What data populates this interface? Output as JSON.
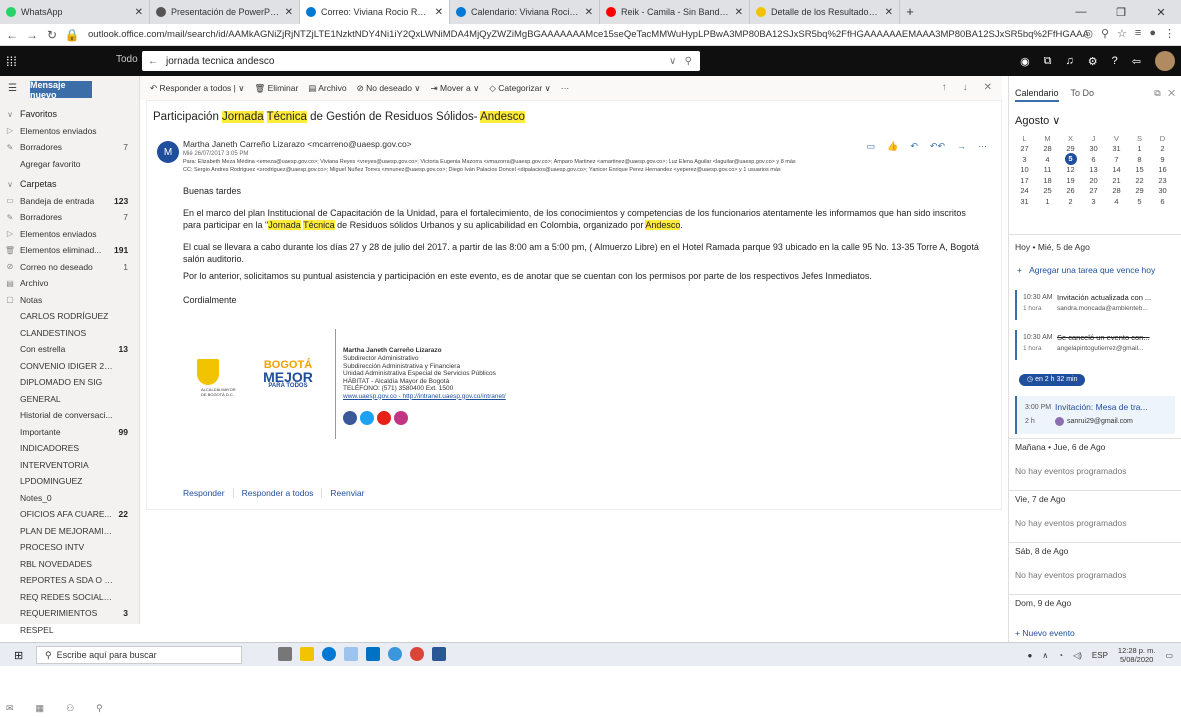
{
  "browser": {
    "tabs": [
      {
        "title": "WhatsApp",
        "color": "#25d366",
        "active": false
      },
      {
        "title": "Presentación de PowerPoint",
        "color": "#555555",
        "active": false
      },
      {
        "title": "Correo: Viviana Rocio Reyes Duc",
        "color": "#0078d4",
        "active": true
      },
      {
        "title": "Calendario: Viviana Rocio Reyes",
        "color": "#0078d4",
        "active": false
      },
      {
        "title": "Reik - Camila - Sin Bandera,",
        "color": "#ff0000",
        "active": false
      },
      {
        "title": "Detalle de los Resultados de la p",
        "color": "#f2c300",
        "active": false
      }
    ],
    "url": "outlook.office.com/mail/search/id/AAMkAGNiZjRjNTZjLTE1NzktNDY4Ni1iY2QxLWNiMDA4MjQyZWZiMgBGAAAAAAAMce15seQeTacMMWuHypLPBwA3MP80BA12SJxSR5bq%2FfHGAAAAAAEMAAA3MP80BA12SJxSR5bq%2FfHGAAAIKZujAAA%3D"
  },
  "owa": {
    "scope": "Todo",
    "search_value": "jornada tecnica andesco"
  },
  "leftnav": {
    "new_message": "Mensaje nuevo",
    "favorites_header": "Favoritos",
    "favorites": [
      {
        "label": "Elementos enviados",
        "count": "",
        "icon": "▷"
      },
      {
        "label": "Borradores",
        "count": "7",
        "icon": "✎"
      },
      {
        "label": "Agregar favorito",
        "count": "",
        "icon": ""
      }
    ],
    "folders_header": "Carpetas",
    "folders": [
      {
        "label": "Bandeja de entrada",
        "count": "123",
        "icon": "▭",
        "bold": true
      },
      {
        "label": "Borradores",
        "count": "7",
        "icon": "✎",
        "bold": false
      },
      {
        "label": "Elementos enviados",
        "count": "",
        "icon": "▷",
        "bold": false
      },
      {
        "label": "Elementos eliminad...",
        "count": "191",
        "icon": "🗑",
        "bold": true
      },
      {
        "label": "Correo no deseado",
        "count": "1",
        "icon": "⊘",
        "bold": false
      },
      {
        "label": "Archivo",
        "count": "",
        "icon": "▤",
        "bold": false
      },
      {
        "label": "Notas",
        "count": "",
        "icon": "▢",
        "bold": false
      }
    ],
    "subfolders": [
      {
        "label": "CARLOS RODRÍGUEZ",
        "count": ""
      },
      {
        "label": "CLANDESTINOS",
        "count": ""
      },
      {
        "label": "Con estrella",
        "count": "13"
      },
      {
        "label": "CONVENIO IDIGER 2015",
        "count": ""
      },
      {
        "label": "DIPLOMADO EN SIG",
        "count": ""
      },
      {
        "label": "GENERAL",
        "count": ""
      },
      {
        "label": "Historial de conversaci...",
        "count": ""
      },
      {
        "label": "Importante",
        "count": "99"
      },
      {
        "label": "INDICADORES",
        "count": ""
      },
      {
        "label": "INTERVENTORIA",
        "count": ""
      },
      {
        "label": "LPDOMINGUEZ",
        "count": ""
      },
      {
        "label": "Notes_0",
        "count": ""
      },
      {
        "label": "OFICIOS AFA CUARE...",
        "count": "22"
      },
      {
        "label": "PLAN DE MEJORAMIEN...",
        "count": ""
      },
      {
        "label": "PROCESO INTV",
        "count": ""
      },
      {
        "label": "RBL NOVEDADES",
        "count": ""
      },
      {
        "label": "REPORTES A SDA O SD...",
        "count": ""
      },
      {
        "label": "REQ REDES SOCIALES",
        "count": ""
      },
      {
        "label": "REQUERIMIENTOS",
        "count": "3"
      },
      {
        "label": "RESPEL",
        "count": ""
      }
    ]
  },
  "toolbar": {
    "reply_all": "Responder a todos",
    "delete": "Eliminar",
    "archive": "Archivo",
    "junk": "No deseado",
    "move": "Mover a",
    "categorize": "Categorizar",
    "more": "···"
  },
  "email": {
    "subject_before": "Participación ",
    "subject_hl1": "Jornada",
    "subject_sp": " ",
    "subject_hl2": "Técnica",
    "subject_mid": " de Gestión de Residuos Sólidos- ",
    "subject_hl3": "Andesco",
    "avatar_letter": "M",
    "from": "Martha Janeth Carreño Lizarazo <mcarreno@uaesp.gov.co>",
    "date": "Mié 26/07/2017 3:05 PM",
    "to": "Para: Elizabeth Meza Médina <emeza@uaesp.gov.co>; Viviana Reyes <vreyes@uaesp.gov.co>; Victoria Eugenia Mazorra <vmazorra@uaesp.gov.co>; Amparo Martinez <amartinez@uaesp.gov.co>; Luz Elena Aguilar <laguilar@uaesp.gov.co> y 8 más",
    "cc": "CC: Sergio Andres Rodriguez <srodriguez@uaesp.gov.co>; Miguel Nuñez Torres <mnunez@uaesp.gov.co>; Diego Iván Palacios Doncel <dipalacios@uaesp.gov.co>; Yanicer Enrique Perez Hernandez <yeperez@uaesp.gov.co> y 1 usuarios más",
    "greeting": "Buenas tardes",
    "p1_a": "En el marco del plan Institucional de Capacitación de la Unidad, para el fortalecimiento, de los conocimientos y competencias de los funcionarios atentamente les informamos que han sido inscritos para participar en la \"",
    "p1_hl1": "Jornada",
    "p1_sp": " ",
    "p1_hl2": "Técnica",
    "p1_b": " de Residuos sólidos Urbanos y su aplicabilidad en Colombia, organizado por ",
    "p1_hl3": "Andesco",
    "p1_c": ".",
    "p2": "El cual se llevara a cabo durante los días 27 y 28 de julio del 2017. a partir de las 8:00 am a 5:00 pm, ( Almuerzo Libre) en el Hotel Ramada parque 93 ubicado en la calle 95 No. 13-35 Torre A, Bogotá salón auditorio.",
    "p3": "Por lo anterior, solicitamos su puntual asistencia y participación en este evento, es de anotar que se cuentan con los permisos por parte de los respectivos Jefes Inmediatos.",
    "closing": "Cordialmente",
    "sig": {
      "name": "Martha Janeth Carreño Lizarazo",
      "l1": "Subdirector Administrativo",
      "l2": "Subdirección Administrativa y Financiera",
      "l3": "Unidad Administrativa Especial de Servicios Públicos",
      "l4": "HÁBITAT - Alcaldía Mayor de Bogotá",
      "l5": "TELÉFONO: (571) 3580400 Ext. 1500",
      "l6": "www.uaesp.gov.co - http://intranet.uaesp.gov.co/intranet/",
      "logo_city": "ALCALDÍA MAYOR DE BOGOTÁ D.C.",
      "logo_a": "BOGOTÁ",
      "logo_b": "MEJOR",
      "logo_c": "PARA TODOS"
    },
    "reply": "Responder",
    "reply_all": "Responder a todos",
    "forward": "Reenviar"
  },
  "calendar": {
    "tab_calendar": "Calendario",
    "tab_todo": "To Do",
    "month": "Agosto",
    "weekdays": [
      "L",
      "M",
      "X",
      "J",
      "V",
      "S",
      "D"
    ],
    "weeks": [
      [
        "27",
        "28",
        "29",
        "30",
        "31",
        "1",
        "2"
      ],
      [
        "3",
        "4",
        "5",
        "6",
        "7",
        "8",
        "9"
      ],
      [
        "10",
        "11",
        "12",
        "13",
        "14",
        "15",
        "16"
      ],
      [
        "17",
        "18",
        "19",
        "20",
        "21",
        "22",
        "23"
      ],
      [
        "24",
        "25",
        "26",
        "27",
        "28",
        "29",
        "30"
      ],
      [
        "31",
        "1",
        "2",
        "3",
        "4",
        "5",
        "6"
      ]
    ],
    "today_header": "Hoy • Mié, 5 de Ago",
    "add_task": "Agregar una tarea que vence hoy",
    "events": [
      {
        "time": "10:30 AM",
        "title": "Invitación actualizada con ...",
        "dur": "1 hora",
        "org": "sandra.moncada@ambienteb..."
      },
      {
        "time": "10:30 AM",
        "title": "Se canceló un evento con...",
        "dur": "1 hora",
        "org": "angelapintogutierrez@gmail..."
      }
    ],
    "pill": "en 2 h 32 min",
    "event3": {
      "time": "3:00 PM",
      "title": "Invitación: Mesa de tra...",
      "dur": "2 h",
      "org": "sanrui29@gmail.com"
    },
    "days": [
      {
        "header": "Mañana • Jue, 6 de Ago",
        "text": "No hay eventos programados"
      },
      {
        "header": "Vie, 7 de Ago",
        "text": "No hay eventos programados"
      },
      {
        "header": "Sáb, 8 de Ago",
        "text": "No hay eventos programados"
      },
      {
        "header": "Dom, 9 de Ago",
        "text": ""
      }
    ],
    "new_event": "+ Nuevo evento"
  },
  "taskbar": {
    "search_placeholder": "Escribe aquí para buscar",
    "lang": "ESP",
    "time": "12:28 p. m.",
    "date": "5/08/2020"
  }
}
